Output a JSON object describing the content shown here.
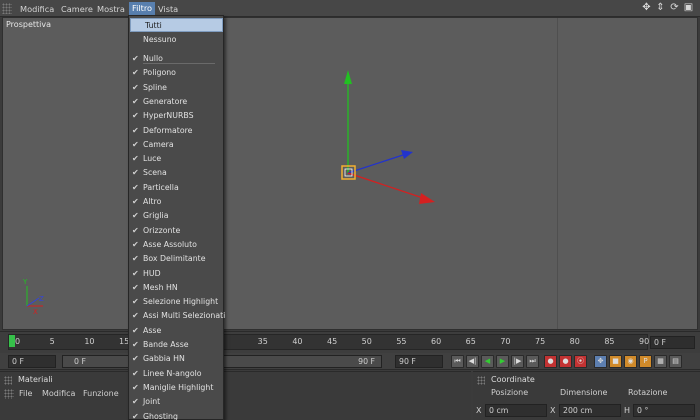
{
  "menubar": {
    "items": [
      "Modifica",
      "Camere",
      "Mostra",
      "Filtro",
      "Vista"
    ],
    "active": "Filtro",
    "nav_icons": [
      "move-icon",
      "dolly-icon",
      "rotate-icon",
      "maximize-icon"
    ]
  },
  "viewport": {
    "label": "Prospettiva",
    "axis_colors": {
      "x": "#d82020",
      "y": "#20c020",
      "z": "#2030d0"
    }
  },
  "filter_menu": {
    "top_items": [
      "Tutti",
      "Nessuno"
    ],
    "checked_items": [
      "Nullo",
      "Poligono",
      "Spline",
      "Generatore",
      "HyperNURBS",
      "Deformatore",
      "Camera",
      "Luce",
      "Scena",
      "Particella",
      "Altro",
      "Griglia",
      "Orizzonte",
      "Asse Assoluto",
      "Box Delimitante",
      "HUD",
      "Mesh HN",
      "Selezione Highlight",
      "Assi Multi Selezionati",
      "Asse",
      "Bande Asse",
      "Gabbia HN",
      "Linee N-angolo",
      "Maniglie Highlight",
      "Joint",
      "Ghosting"
    ]
  },
  "timeline": {
    "ticks": [
      "0",
      "5",
      "10",
      "15",
      "35",
      "40",
      "45",
      "50",
      "55",
      "60",
      "65",
      "70",
      "75",
      "80",
      "85",
      "90"
    ],
    "current_frame": "0 F"
  },
  "transport": {
    "start_frame": "0 F",
    "range_start": "0 F",
    "range_end": "90 F",
    "end_frame": "90 F"
  },
  "materials_panel": {
    "title": "Materiali",
    "menu": [
      "File",
      "Modifica",
      "Funzione"
    ]
  },
  "coordinates_panel": {
    "title": "Coordinate",
    "headers": [
      "Posizione",
      "Dimensione",
      "Rotazione"
    ],
    "row": {
      "axis1": "X",
      "pos": "0 cm",
      "axis2": "X",
      "size": "200 cm",
      "axis3": "H",
      "rot": "0 °"
    }
  }
}
